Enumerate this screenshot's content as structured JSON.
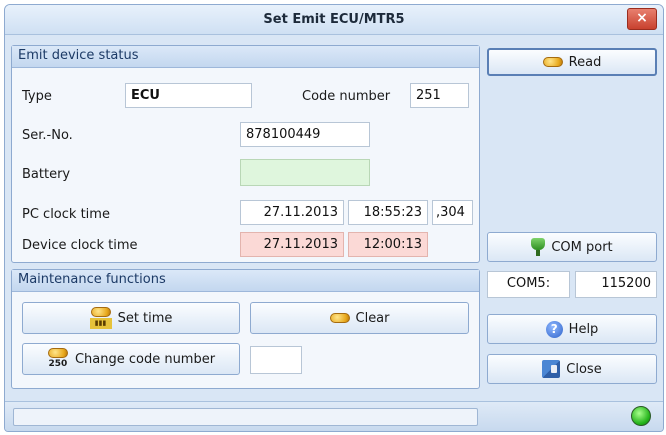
{
  "window": {
    "title": "Set Emit ECU/MTR5",
    "close_glyph": "×"
  },
  "status_panel": {
    "header": "Emit device status",
    "type_label": "Type",
    "type_value": "ECU",
    "code_number_label": "Code number",
    "code_number_value": "251",
    "serial_label": "Ser.-No.",
    "serial_value": "878100449",
    "battery_label": "Battery",
    "battery_value": "",
    "pc_clock_label": "PC clock time",
    "pc_date": "27.11.2013",
    "pc_time": "18:55:23",
    "pc_ms": ",304",
    "device_clock_label": "Device clock time",
    "device_date": "27.11.2013",
    "device_time": "12:00:13"
  },
  "maintenance_panel": {
    "header": "Maintenance functions",
    "set_time_label": "Set time",
    "clear_label": "Clear",
    "change_code_label": "Change code number",
    "code_input_value": "",
    "code_icon_text": "250"
  },
  "right_column": {
    "read_label": "Read",
    "com_port_label": "COM port",
    "com_port_value": "COM5:",
    "baud_value": "115200",
    "help_label": "Help",
    "close_label": "Close",
    "help_glyph": "?"
  },
  "icons": {
    "read": "key-icon",
    "set_time": "clock-key-icon",
    "clear": "key-icon",
    "change_code": "code-key-icon",
    "com_port": "plug-icon",
    "help": "help-icon",
    "close": "exit-icon",
    "status": "status-led-icon"
  },
  "colors": {
    "battery_ok": "#dff6dd",
    "device_clock_warning": "#fbd9d6",
    "status_led": "#24b31a",
    "title_close": "#c8412e"
  }
}
